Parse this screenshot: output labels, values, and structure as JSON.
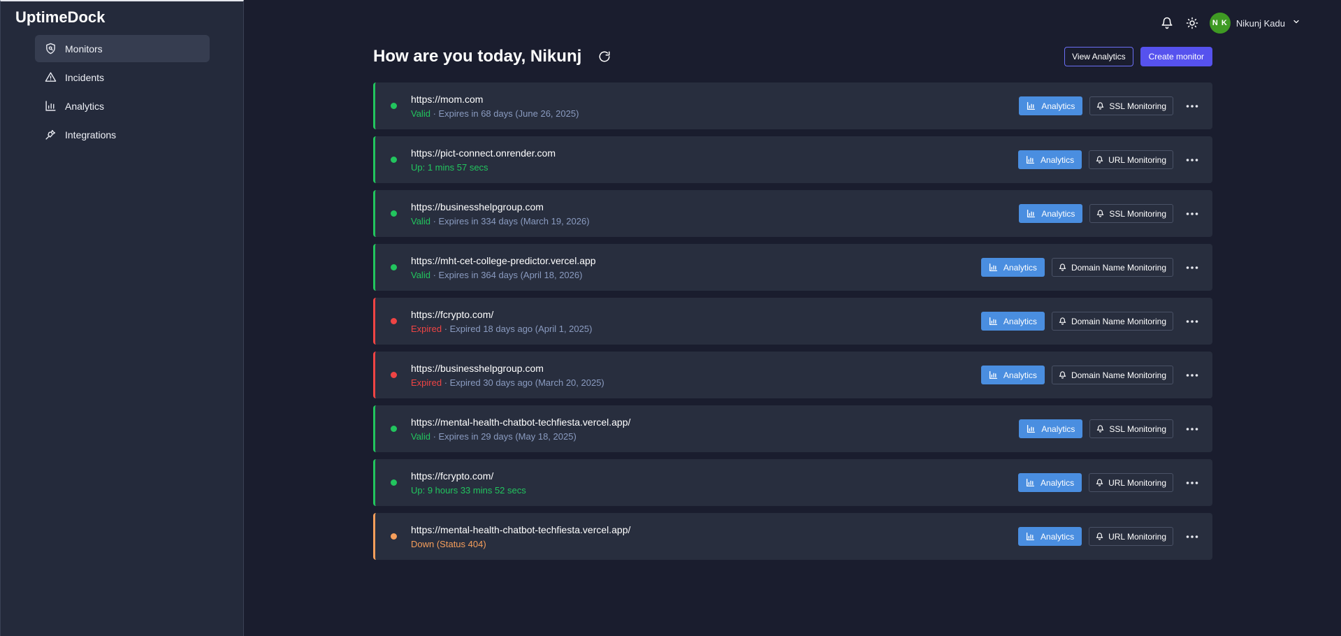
{
  "app": {
    "name": "UptimeDock"
  },
  "sidebar": {
    "items": [
      {
        "label": "Monitors",
        "icon": "shield-search-icon",
        "active": true
      },
      {
        "label": "Incidents",
        "icon": "warning-triangle-icon",
        "active": false
      },
      {
        "label": "Analytics",
        "icon": "bar-chart-icon",
        "active": false
      },
      {
        "label": "Integrations",
        "icon": "plug-icon",
        "active": false
      }
    ]
  },
  "user": {
    "initials": "N K",
    "name": "Nikunj Kadu",
    "avatar_color": "#3f9a23"
  },
  "header": {
    "greeting": "How are you today, Nikunj",
    "view_analytics": "View Analytics",
    "create_monitor": "Create monitor"
  },
  "colors": {
    "background": "#1a1d2e",
    "sidebar": "#242a3b",
    "card": "#282e3e",
    "up": "#22c55e",
    "expired": "#ef4444",
    "down": "#f59e5b",
    "analytics_button": "#4a8ee0",
    "primary_button": "#5652ee"
  },
  "monitors": [
    {
      "url": "https://mom.com",
      "state": "green",
      "status": "Valid",
      "detail": " · Expires in 68 days (June 26, 2025)",
      "analytics": "Analytics",
      "type": "SSL Monitoring"
    },
    {
      "url": "https://pict-connect.onrender.com",
      "state": "green",
      "status": "Up: 1 mins 57 secs",
      "detail": "",
      "analytics": "Analytics",
      "type": "URL Monitoring"
    },
    {
      "url": "https://businesshelpgroup.com",
      "state": "green",
      "status": "Valid",
      "detail": " · Expires in 334 days (March 19, 2026)",
      "analytics": "Analytics",
      "type": "SSL Monitoring"
    },
    {
      "url": "https://mht-cet-college-predictor.vercel.app",
      "state": "green",
      "status": "Valid",
      "detail": " · Expires in 364 days (April 18, 2026)",
      "analytics": "Analytics",
      "type": "Domain Name Monitoring"
    },
    {
      "url": "https://fcrypto.com/",
      "state": "red",
      "status": "Expired",
      "detail": " · Expired 18 days ago (April 1, 2025)",
      "analytics": "Analytics",
      "type": "Domain Name Monitoring"
    },
    {
      "url": "https://businesshelpgroup.com",
      "state": "red",
      "status": "Expired",
      "detail": " · Expired 30 days ago (March 20, 2025)",
      "analytics": "Analytics",
      "type": "Domain Name Monitoring"
    },
    {
      "url": "https://mental-health-chatbot-techfiesta.vercel.app/",
      "state": "green",
      "status": "Valid",
      "detail": " · Expires in 29 days (May 18, 2025)",
      "analytics": "Analytics",
      "type": "SSL Monitoring"
    },
    {
      "url": "https://fcrypto.com/",
      "state": "green",
      "status": "Up: 9 hours 33 mins 52 secs",
      "detail": "",
      "analytics": "Analytics",
      "type": "URL Monitoring"
    },
    {
      "url": "https://mental-health-chatbot-techfiesta.vercel.app/",
      "state": "orange",
      "status": "Down (Status 404)",
      "detail": "",
      "analytics": "Analytics",
      "type": "URL Monitoring"
    }
  ]
}
